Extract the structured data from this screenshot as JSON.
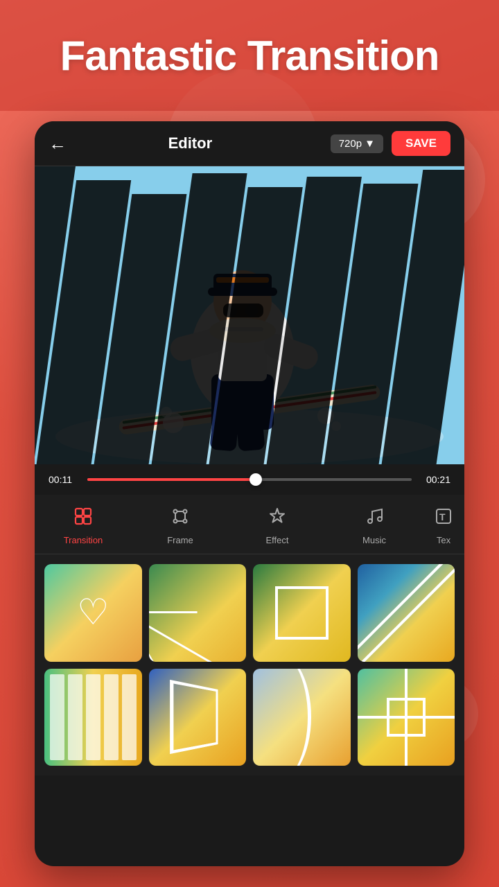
{
  "app": {
    "headline": "Fantastic Transition"
  },
  "editor": {
    "back_icon": "←",
    "title": "Editor",
    "quality_label": "720p",
    "quality_arrow": "▼",
    "save_label": "SAVE"
  },
  "timeline": {
    "current_time": "00:11",
    "end_time": "00:21",
    "progress_percent": 52
  },
  "toolbar": {
    "items": [
      {
        "id": "transition",
        "label": "Transition",
        "icon": "transition",
        "active": true
      },
      {
        "id": "frame",
        "label": "Frame",
        "icon": "frame",
        "active": false
      },
      {
        "id": "effect",
        "label": "Effect",
        "icon": "effect",
        "active": false
      },
      {
        "id": "music",
        "label": "Music",
        "icon": "music",
        "active": false
      },
      {
        "id": "text",
        "label": "Tex",
        "icon": "text",
        "active": false
      }
    ]
  },
  "thumbnails": [
    {
      "id": "heart",
      "type": "heart"
    },
    {
      "id": "star",
      "type": "star"
    },
    {
      "id": "rect",
      "type": "rect"
    },
    {
      "id": "diagonal",
      "type": "diagonal"
    },
    {
      "id": "stripes",
      "type": "stripes"
    },
    {
      "id": "box3d",
      "type": "box3d"
    },
    {
      "id": "curve",
      "type": "curve"
    },
    {
      "id": "cross",
      "type": "cross"
    }
  ]
}
